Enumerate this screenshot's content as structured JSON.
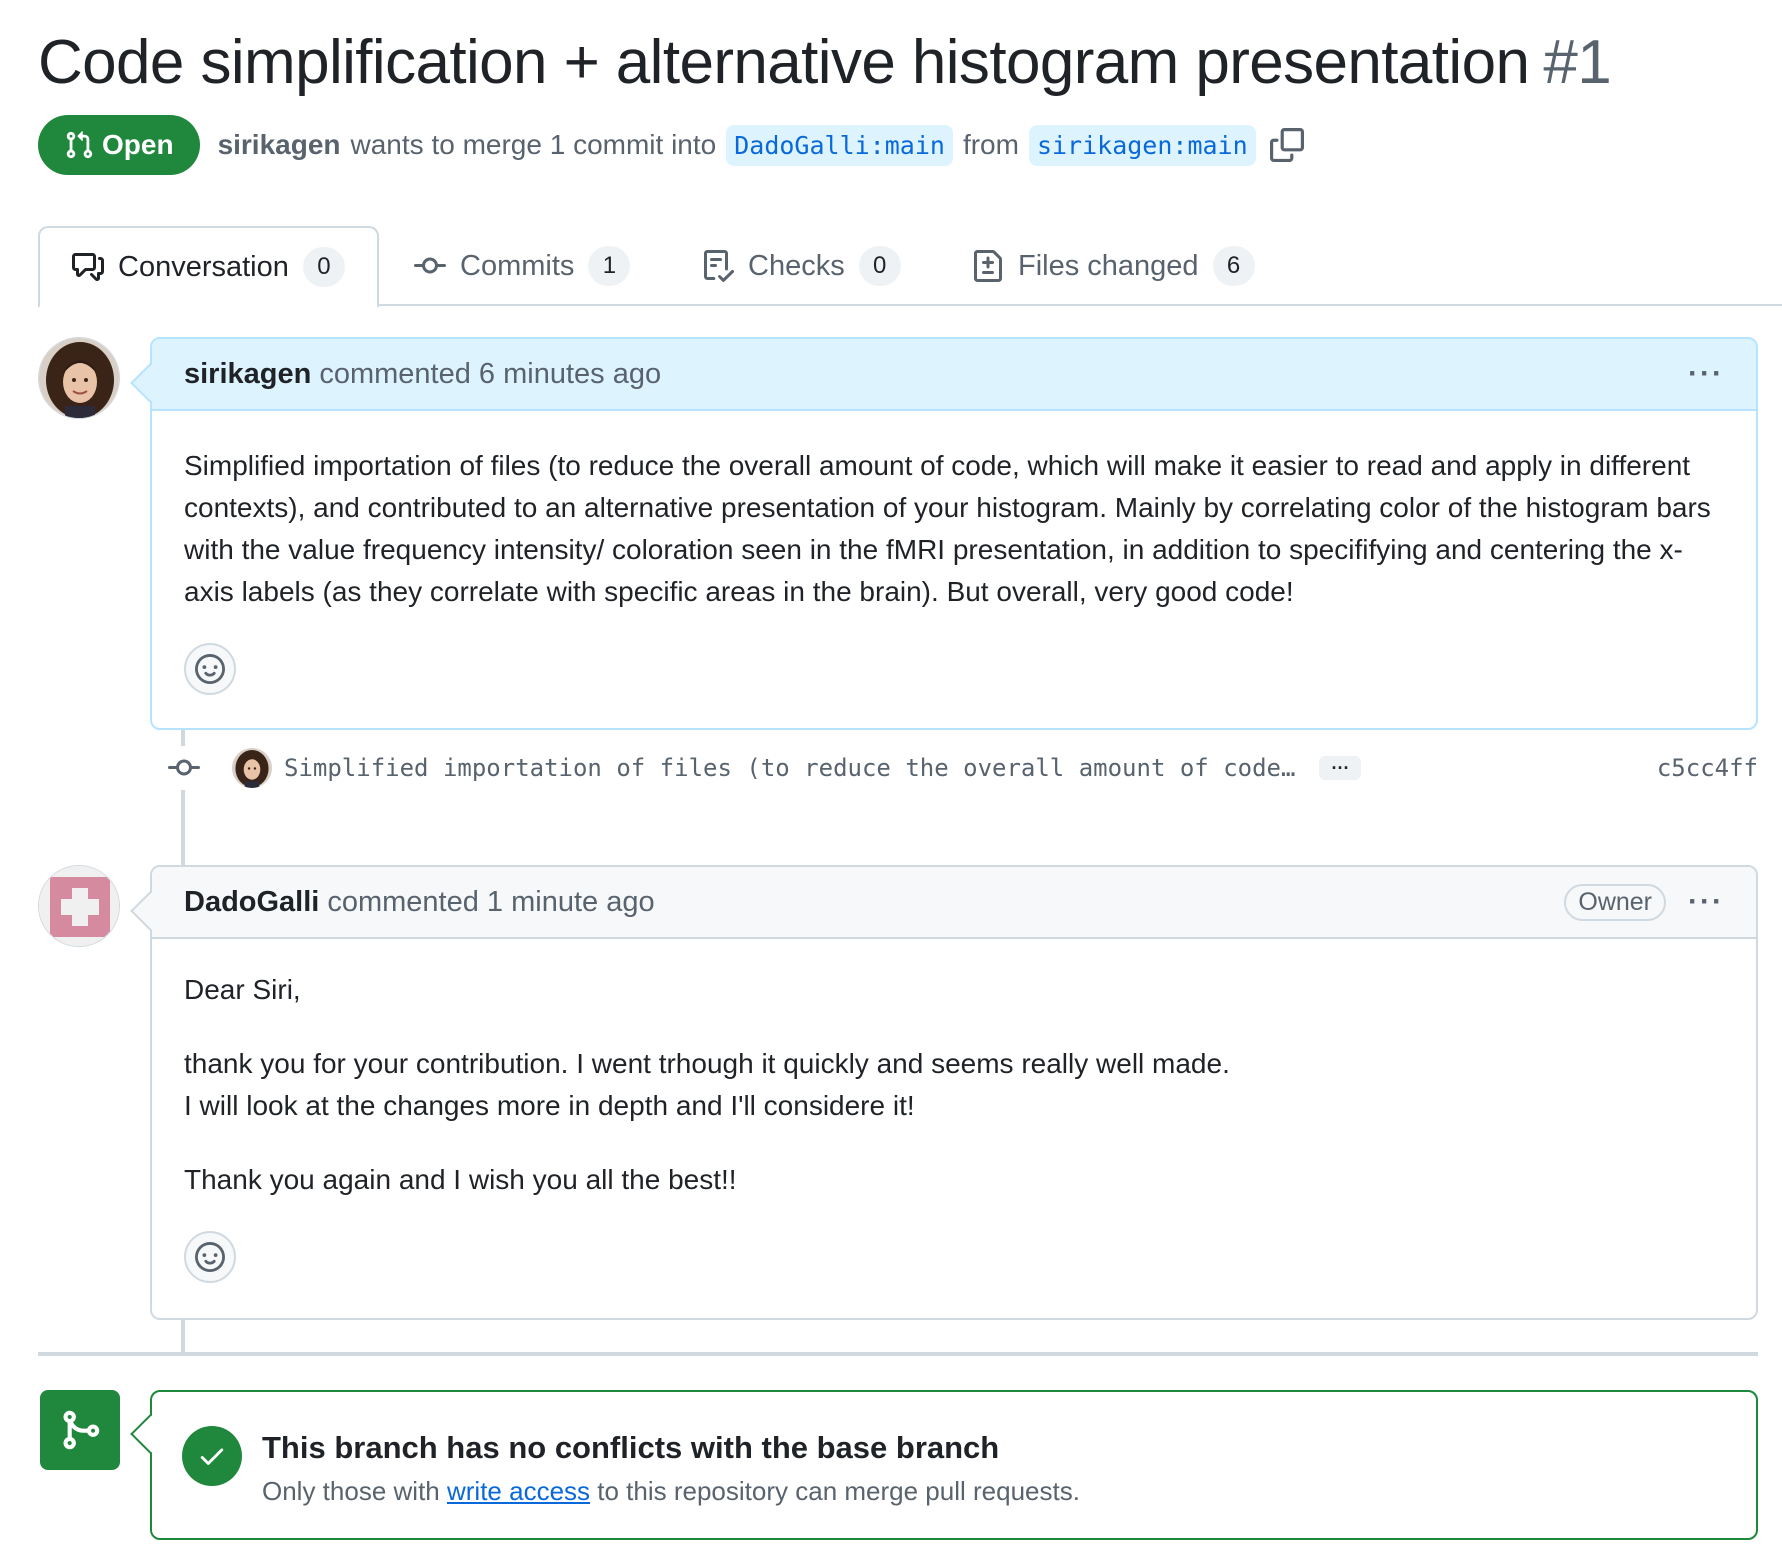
{
  "pull_request": {
    "title": "Code simplification + alternative histogram presentation",
    "number": "#1",
    "state": "Open",
    "author": "sirikagen",
    "merge_text": "wants to merge 1 commit into",
    "base_branch": "DadoGalli:main",
    "from_text": "from",
    "head_branch": "sirikagen:main"
  },
  "tabs": [
    {
      "label": "Conversation",
      "count": "0",
      "icon": "comment-discussion-icon"
    },
    {
      "label": "Commits",
      "count": "1",
      "icon": "git-commit-icon"
    },
    {
      "label": "Checks",
      "count": "0",
      "icon": "checklist-icon"
    },
    {
      "label": "Files changed",
      "count": "6",
      "icon": "file-diff-icon"
    }
  ],
  "comments": [
    {
      "author": "sirikagen",
      "action": "commented 6 minutes ago",
      "kebab": "···",
      "body": [
        "Simplified importation of files (to reduce the overall amount of code, which will make it easier to read and apply in different contexts), and contributed to an alternative presentation of your histogram. Mainly by correlating color of the histogram bars with the value frequency intensity/ coloration seen in the fMRI presentation, in addition to specififying and centering the x-axis labels (as they correlate with specific areas in the brain). But overall, very good code!"
      ]
    },
    {
      "author": "DadoGalli",
      "action": "commented 1 minute ago",
      "role": "Owner",
      "kebab": "···",
      "body": [
        "Dear Siri,",
        "thank you for your contribution. I went trhough it quickly and seems really well made.",
        "I will look at the changes more in depth and I'll considere it!",
        "Thank you again and I wish you all the best!!"
      ]
    }
  ],
  "commit": {
    "message": "Simplified importation of files (to reduce the overall amount of code…",
    "ellipsis": "···",
    "sha": "c5cc4ff"
  },
  "merge_status": {
    "title": "This branch has no conflicts with the base branch",
    "sub_before": "Only those with",
    "sub_link": "write access",
    "sub_after": "to this repository can merge pull requests."
  },
  "colors": {
    "open_green": "#1f883d",
    "link_blue": "#0969da",
    "author_header_bg": "#ddf4ff"
  }
}
